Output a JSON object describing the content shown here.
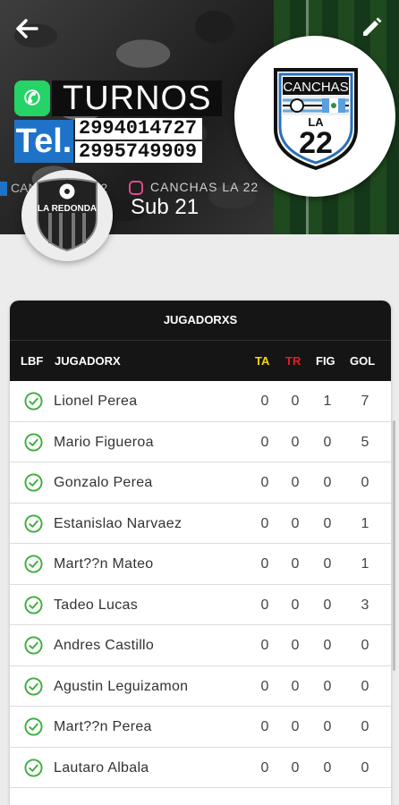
{
  "header": {
    "banner": {
      "turnos": "TURNOS",
      "tel": "Tel.",
      "phones": [
        "2994014727",
        "2995749909"
      ],
      "facebook_text": "CANCHAS LA 22",
      "instagram_text": "CANCHAS LA 22"
    },
    "logo": {
      "top_text": "CANCHAS",
      "mid_text": "LA",
      "number": "22"
    },
    "team": {
      "crest_label": "LA REDONDA",
      "category": "Sub 21"
    },
    "icons": {
      "back": "arrow-left-icon",
      "edit": "pencil-icon"
    }
  },
  "table": {
    "title": "JUGADORXS",
    "columns": {
      "lbf": "LBF",
      "name": "JUGADORX",
      "ta": "TA",
      "tr": "TR",
      "fig": "FIG",
      "gol": "GOL"
    },
    "rows": [
      {
        "name": "Lionel Perea",
        "ta": "0",
        "tr": "0",
        "fig": "1",
        "gol": "7"
      },
      {
        "name": "Mario Figueroa",
        "ta": "0",
        "tr": "0",
        "fig": "0",
        "gol": "5"
      },
      {
        "name": "Gonzalo Perea",
        "ta": "0",
        "tr": "0",
        "fig": "0",
        "gol": "0"
      },
      {
        "name": "Estanislao Narvaez",
        "ta": "0",
        "tr": "0",
        "fig": "0",
        "gol": "1"
      },
      {
        "name": "Mart??n Mateo",
        "ta": "0",
        "tr": "0",
        "fig": "0",
        "gol": "1"
      },
      {
        "name": "Tadeo Lucas",
        "ta": "0",
        "tr": "0",
        "fig": "0",
        "gol": "3"
      },
      {
        "name": "Andres Castillo",
        "ta": "0",
        "tr": "0",
        "fig": "0",
        "gol": "0"
      },
      {
        "name": "Agustin Leguizamon",
        "ta": "0",
        "tr": "0",
        "fig": "0",
        "gol": "0"
      },
      {
        "name": "Mart??n Perea",
        "ta": "0",
        "tr": "0",
        "fig": "0",
        "gol": "0"
      },
      {
        "name": "Lautaro Albala",
        "ta": "0",
        "tr": "0",
        "fig": "0",
        "gol": "0"
      }
    ]
  },
  "colors": {
    "ta": "#f5d800",
    "tr": "#e02020",
    "check": "#3cae3c",
    "header_bg": "#151515"
  }
}
